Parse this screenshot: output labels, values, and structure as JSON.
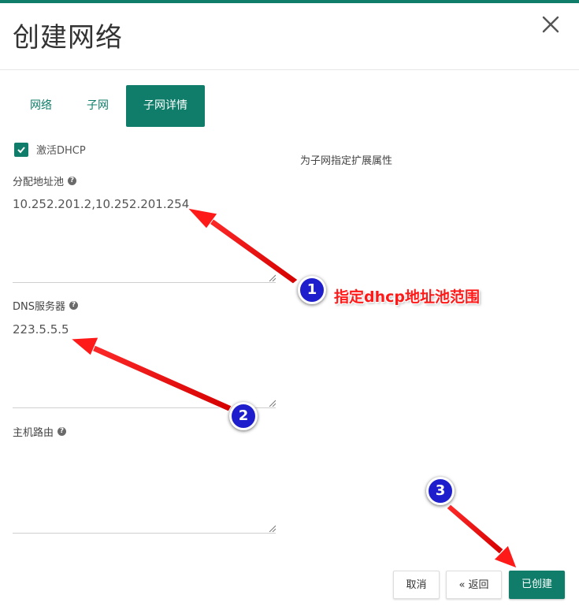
{
  "dialog": {
    "title": "创建网络",
    "tabs": [
      {
        "label": "网络"
      },
      {
        "label": "子网"
      },
      {
        "label": "子网详情"
      }
    ],
    "dhcp": {
      "checked": true,
      "label": "激活DHCP"
    },
    "hint": "为子网指定扩展属性",
    "fields": {
      "pool": {
        "label": "分配地址池",
        "value": "10.252.201.2,10.252.201.254"
      },
      "dns": {
        "label": "DNS服务器",
        "value": "223.5.5.5"
      },
      "routes": {
        "label": "主机路由",
        "value": ""
      }
    },
    "help_icon_glyph": "?",
    "buttons": {
      "cancel": "取消",
      "back": "« 返回",
      "create": "已创建"
    }
  },
  "annotations": {
    "note": "指定dhcp地址池范围",
    "badges": [
      "1",
      "2",
      "3"
    ],
    "color": "#ff1a1a",
    "badge_color": "#1e1ecc"
  },
  "colors": {
    "accent": "#0f7d6a"
  }
}
